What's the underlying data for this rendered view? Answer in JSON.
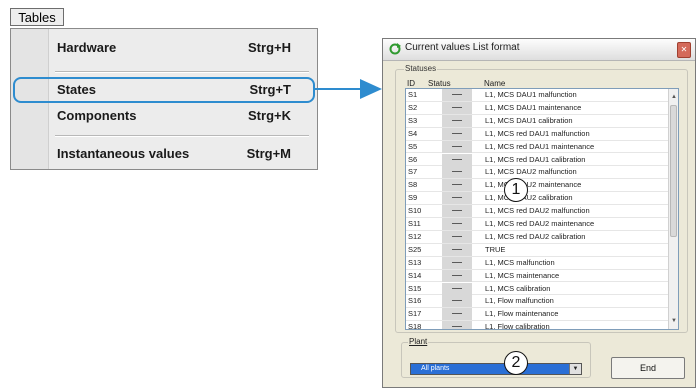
{
  "menu": {
    "title": "Tables",
    "items": [
      {
        "label": "Hardware",
        "shortcut": "Strg+H"
      },
      {
        "label": "States",
        "shortcut": "Strg+T"
      },
      {
        "label": "Components",
        "shortcut": "Strg+K"
      },
      {
        "label": "Instantaneous values",
        "shortcut": "Strg+M"
      }
    ],
    "highlighted_item": "States",
    "highlight_color": "#2e8ccf"
  },
  "dialog": {
    "title": "Current values List format",
    "statuses_label": "Statuses",
    "columns": [
      "ID",
      "Status",
      "Name"
    ],
    "rows": [
      {
        "id": "S1",
        "status": "—",
        "name": "L1, MCS DAU1 malfunction"
      },
      {
        "id": "S2",
        "status": "—",
        "name": "L1, MCS DAU1 maintenance"
      },
      {
        "id": "S3",
        "status": "—",
        "name": "L1, MCS DAU1 calibration"
      },
      {
        "id": "S4",
        "status": "—",
        "name": "L1, MCS red DAU1 malfunction"
      },
      {
        "id": "S5",
        "status": "—",
        "name": "L1, MCS red DAU1 maintenance"
      },
      {
        "id": "S6",
        "status": "—",
        "name": "L1, MCS red DAU1 calibration"
      },
      {
        "id": "S7",
        "status": "—",
        "name": "L1, MCS DAU2 malfunction"
      },
      {
        "id": "S8",
        "status": "—",
        "name": "L1, MCS DAU2 maintenance"
      },
      {
        "id": "S9",
        "status": "—",
        "name": "L1, MCS DAU2 calibration"
      },
      {
        "id": "S10",
        "status": "—",
        "name": "L1, MCS red DAU2 malfunction"
      },
      {
        "id": "S11",
        "status": "—",
        "name": "L1, MCS red DAU2 maintenance"
      },
      {
        "id": "S12",
        "status": "—",
        "name": "L1, MCS red DAU2 calibration"
      },
      {
        "id": "S25",
        "status": "—",
        "name": "TRUE"
      },
      {
        "id": "S13",
        "status": "—",
        "name": "L1, MCS malfunction"
      },
      {
        "id": "S14",
        "status": "—",
        "name": "L1, MCS maintenance"
      },
      {
        "id": "S15",
        "status": "—",
        "name": "L1, MCS calibration"
      },
      {
        "id": "S16",
        "status": "—",
        "name": "L1, Flow malfunction"
      },
      {
        "id": "S17",
        "status": "—",
        "name": "L1, Flow maintenance"
      },
      {
        "id": "S18",
        "status": "—",
        "name": "L1, Flow calibration"
      }
    ],
    "plant_label": "Plant",
    "plant_value": "All plants",
    "end_label": "End"
  },
  "callouts": [
    "1",
    "2"
  ]
}
